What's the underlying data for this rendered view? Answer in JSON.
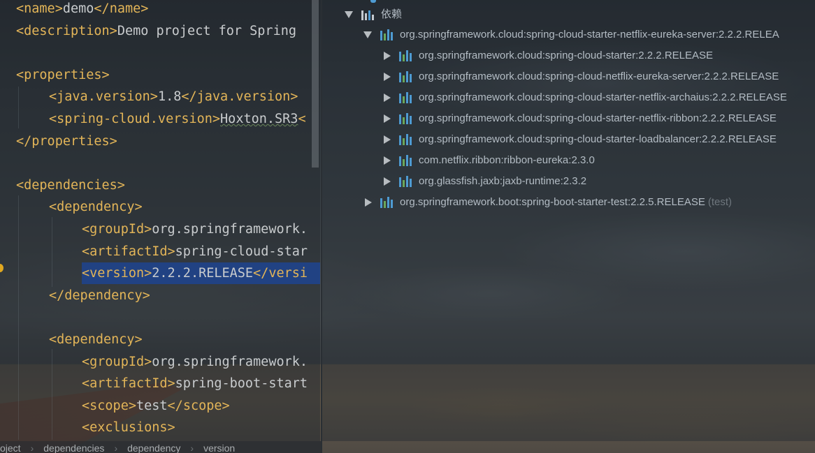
{
  "editor": {
    "lines": [
      {
        "id": "l1",
        "parts": [
          [
            "tag",
            "<"
          ],
          [
            "tag",
            "name"
          ],
          [
            "tag",
            ">"
          ],
          [
            "txt",
            "demo"
          ],
          [
            "tag",
            "</"
          ],
          [
            "tag",
            "name"
          ],
          [
            "tag",
            ">"
          ]
        ]
      },
      {
        "id": "l2",
        "parts": [
          [
            "tag",
            "<"
          ],
          [
            "tag",
            "description"
          ],
          [
            "tag",
            ">"
          ],
          [
            "txt",
            "Demo project for Spring "
          ]
        ]
      },
      {
        "id": "l3",
        "parts": []
      },
      {
        "id": "l4",
        "parts": [
          [
            "tag",
            "<"
          ],
          [
            "tag",
            "properties"
          ],
          [
            "tag",
            ">"
          ]
        ]
      },
      {
        "id": "l5",
        "parts": [
          [
            "tag",
            "<"
          ],
          [
            "tag",
            "java.version"
          ],
          [
            "tag",
            ">"
          ],
          [
            "txt",
            "1.8"
          ],
          [
            "tag",
            "</"
          ],
          [
            "tag",
            "java.version"
          ],
          [
            "tag",
            ">"
          ]
        ]
      },
      {
        "id": "l6",
        "parts": [
          [
            "tag",
            "<"
          ],
          [
            "tag",
            "spring-cloud.version"
          ],
          [
            "tag",
            ">"
          ],
          [
            "squig",
            "Hoxton.SR3"
          ],
          [
            "tag",
            "<"
          ]
        ]
      },
      {
        "id": "l7",
        "parts": [
          [
            "tag",
            "</"
          ],
          [
            "tag",
            "properties"
          ],
          [
            "tag",
            ">"
          ]
        ]
      },
      {
        "id": "l8",
        "parts": []
      },
      {
        "id": "l9",
        "parts": [
          [
            "tag",
            "<"
          ],
          [
            "tag",
            "dependencies"
          ],
          [
            "tag",
            ">"
          ]
        ]
      },
      {
        "id": "l10",
        "parts": [
          [
            "tag",
            "<"
          ],
          [
            "tag",
            "dependency"
          ],
          [
            "tag",
            ">"
          ]
        ]
      },
      {
        "id": "l11",
        "parts": [
          [
            "tag",
            "<"
          ],
          [
            "tag",
            "groupId"
          ],
          [
            "tag",
            ">"
          ],
          [
            "txt",
            "org.springframework."
          ]
        ]
      },
      {
        "id": "l12",
        "parts": [
          [
            "tag",
            "<"
          ],
          [
            "tag",
            "artifactId"
          ],
          [
            "tag",
            ">"
          ],
          [
            "txt",
            "spring-cloud-star"
          ]
        ]
      },
      {
        "id": "l13",
        "parts": [
          [
            "tag",
            "<"
          ],
          [
            "tag",
            "version"
          ],
          [
            "tag",
            ">"
          ],
          [
            "txt",
            "2.2.2.RELEASE"
          ],
          [
            "tag",
            "</"
          ],
          [
            "tag",
            "versi"
          ]
        ]
      },
      {
        "id": "l14",
        "parts": [
          [
            "tag",
            "</"
          ],
          [
            "tag",
            "dependency"
          ],
          [
            "tag",
            ">"
          ]
        ]
      },
      {
        "id": "l15",
        "parts": []
      },
      {
        "id": "l16",
        "parts": [
          [
            "tag",
            "<"
          ],
          [
            "tag",
            "dependency"
          ],
          [
            "tag",
            ">"
          ]
        ]
      },
      {
        "id": "l17",
        "parts": [
          [
            "tag",
            "<"
          ],
          [
            "tag",
            "groupId"
          ],
          [
            "tag",
            ">"
          ],
          [
            "txt",
            "org.springframework."
          ]
        ]
      },
      {
        "id": "l18",
        "parts": [
          [
            "tag",
            "<"
          ],
          [
            "tag",
            "artifactId"
          ],
          [
            "tag",
            ">"
          ],
          [
            "txt",
            "spring-boot-start"
          ]
        ]
      },
      {
        "id": "l19",
        "parts": [
          [
            "tag",
            "<"
          ],
          [
            "tag",
            "scope"
          ],
          [
            "tag",
            ">"
          ],
          [
            "txt",
            "test"
          ],
          [
            "tag",
            "</"
          ],
          [
            "tag",
            "scope"
          ],
          [
            "tag",
            ">"
          ]
        ]
      },
      {
        "id": "l20",
        "parts": [
          [
            "tag",
            "<"
          ],
          [
            "tag",
            "exclusions"
          ],
          [
            "tag",
            ">"
          ]
        ]
      }
    ]
  },
  "breadcrumb": [
    "oject",
    "dependencies",
    "dependency",
    "version"
  ],
  "tree": {
    "root_label": "依赖",
    "nodes": [
      {
        "label": "org.springframework.cloud:spring-cloud-starter-netflix-eureka-server:2.2.2.RELEA",
        "expanded": true,
        "scope": ""
      },
      {
        "label": "org.springframework.cloud:spring-cloud-starter:2.2.2.RELEASE",
        "expanded": false,
        "scope": ""
      },
      {
        "label": "org.springframework.cloud:spring-cloud-netflix-eureka-server:2.2.2.RELEASE",
        "expanded": false,
        "scope": ""
      },
      {
        "label": "org.springframework.cloud:spring-cloud-starter-netflix-archaius:2.2.2.RELEASE",
        "expanded": false,
        "scope": ""
      },
      {
        "label": "org.springframework.cloud:spring-cloud-starter-netflix-ribbon:2.2.2.RELEASE",
        "expanded": false,
        "scope": ""
      },
      {
        "label": "org.springframework.cloud:spring-cloud-starter-loadbalancer:2.2.2.RELEASE",
        "expanded": false,
        "scope": ""
      },
      {
        "label": "com.netflix.ribbon:ribbon-eureka:2.3.0",
        "expanded": false,
        "scope": ""
      },
      {
        "label": "org.glassfish.jaxb:jaxb-runtime:2.3.2",
        "expanded": false,
        "scope": ""
      },
      {
        "label": "org.springframework.boot:spring-boot-starter-test:2.2.5.RELEASE",
        "expanded": false,
        "scope": "(test)"
      }
    ]
  },
  "colors": {
    "tag": "#e3b558",
    "text": "#c9ccce",
    "selection": "#214283",
    "library_icon": "#4e9bd2"
  }
}
